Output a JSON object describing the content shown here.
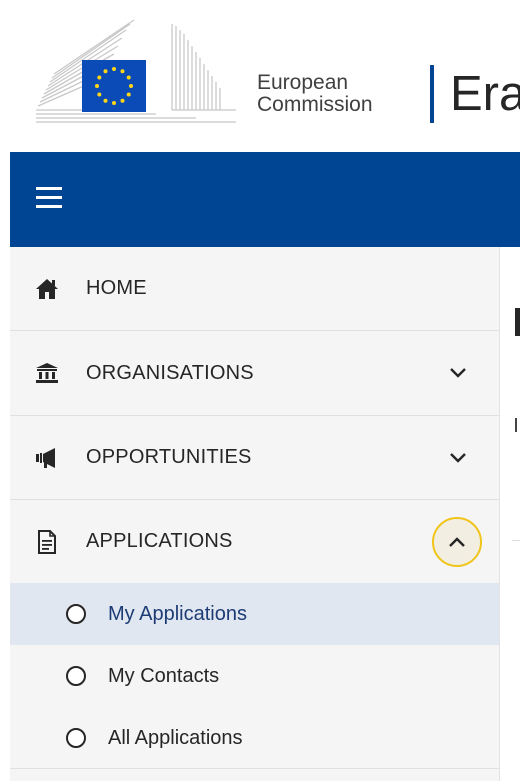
{
  "header": {
    "org_line1": "European",
    "org_line2": "Commission",
    "site_name": "Era"
  },
  "topbar": {
    "menu_icon": "hamburger-icon"
  },
  "sidebar": {
    "items": [
      {
        "label": "HOME",
        "icon": "home-icon"
      },
      {
        "label": "ORGANISATIONS",
        "icon": "institution-icon",
        "expand": "chevron-down-icon"
      },
      {
        "label": "OPPORTUNITIES",
        "icon": "megaphone-icon",
        "expand": "chevron-down-icon"
      },
      {
        "label": "APPLICATIONS",
        "icon": "document-icon",
        "expand": "chevron-up-icon",
        "expanded": true
      }
    ],
    "sub_items": [
      {
        "label": "My Applications",
        "active": true
      },
      {
        "label": "My Contacts",
        "active": false
      },
      {
        "label": "All Applications",
        "active": false
      }
    ]
  },
  "colors": {
    "brand_blue": "#004494",
    "eu_yellow": "#ffd617",
    "focus_ring": "#f0c419",
    "active_bg": "#e1e7f0",
    "active_text": "#1d3c75"
  }
}
